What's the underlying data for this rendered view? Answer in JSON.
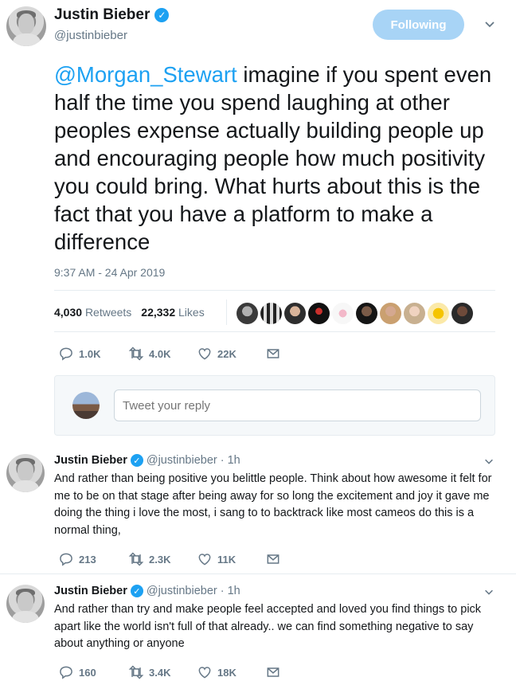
{
  "main_tweet": {
    "author_name": "Justin Bieber",
    "author_handle": "@justinbieber",
    "follow_label": "Following",
    "mention": "@Morgan_Stewart",
    "text": " imagine if you spent even half the time you spend laughing at other peoples expense actually building people up and encouraging people how much positivity you could bring. What hurts about this is the fact that you have a platform to make a difference",
    "timestamp": "9:37 AM - 24 Apr 2019",
    "retweets_count": "4,030",
    "retweets_label": "Retweets",
    "likes_count": "22,332",
    "likes_label": "Likes",
    "actions": {
      "replies": "1.0K",
      "retweets": "4.0K",
      "likes": "22K"
    }
  },
  "reply_box": {
    "placeholder": "Tweet your reply"
  },
  "replies": [
    {
      "author_name": "Justin Bieber",
      "author_handle": "@justinbieber",
      "time": "· 1h",
      "text": "And rather than being positive you belittle people. Think about how awesome it felt for me to be on that stage after being away for so long the excitement and joy it gave me doing the thing i love the most, i sang to to backtrack like most cameos do this is a normal thing,",
      "actions": {
        "replies": "213",
        "retweets": "2.3K",
        "likes": "11K"
      }
    },
    {
      "author_name": "Justin Bieber",
      "author_handle": "@justinbieber",
      "time": "· 1h",
      "text": "And rather than try and make people feel accepted and loved you find things to pick apart like the world isn't full of that already.. we can find something negative to say about anything or anyone",
      "actions": {
        "replies": "160",
        "retweets": "3.4K",
        "likes": "18K"
      }
    }
  ],
  "colors": {
    "accent": "#1da1f2",
    "secondary_text": "#657786",
    "follow_button": "#a8d4f6"
  },
  "icons": [
    "verified-badge-icon",
    "chevron-down-icon",
    "reply-icon",
    "retweet-icon",
    "like-icon",
    "direct-message-icon"
  ]
}
